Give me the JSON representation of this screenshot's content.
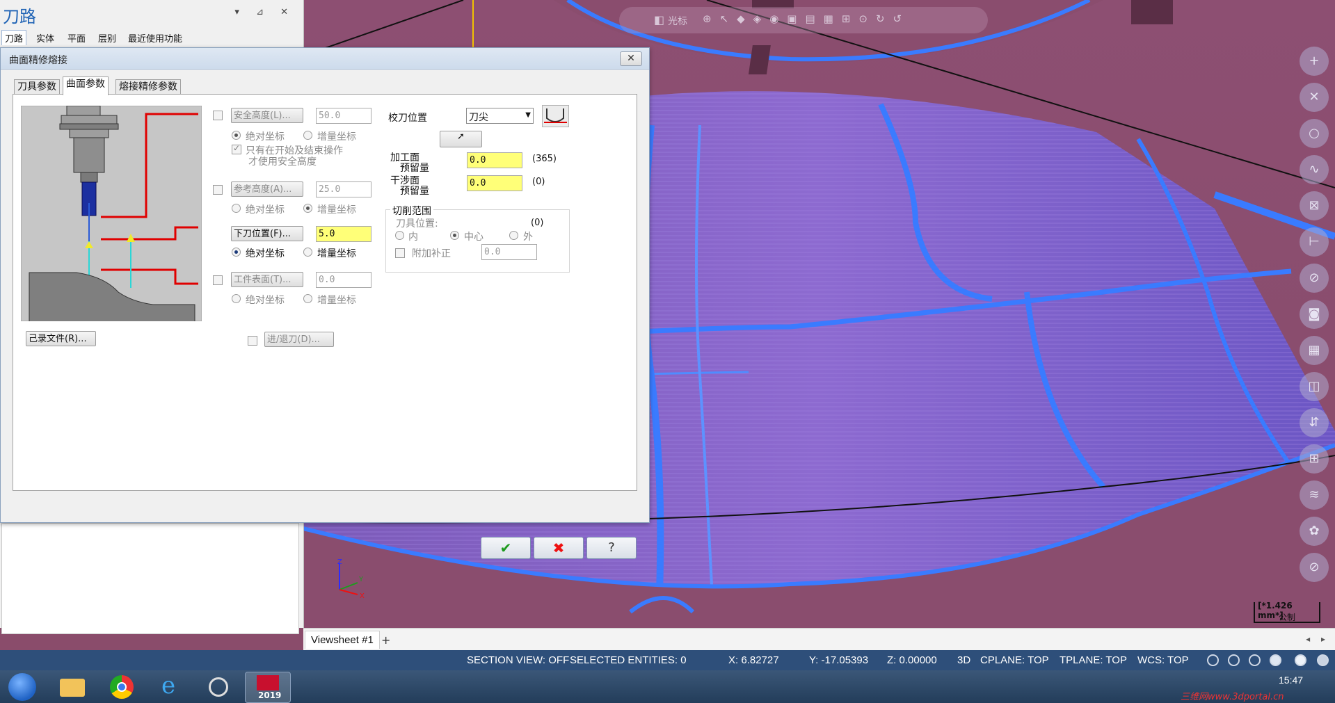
{
  "left_panel": {
    "title": "刀路",
    "controls": "▾ ⊿ ✕",
    "tabs": [
      "刀路",
      "实体",
      "平面",
      "层别",
      "最近使用功能"
    ]
  },
  "dialog": {
    "title": "曲面精修熔接",
    "close_label": "✕",
    "tabs": [
      "刀具参数",
      "曲面参数",
      "熔接精修参数"
    ],
    "record_file_label": "己录文件(R)...",
    "safe_height": {
      "button": "安全高度(L)...",
      "value": "50.0",
      "abs": "绝对坐标",
      "inc": "增量坐标",
      "only_start_end": "只有在开始及结束操作",
      "only_start_end_2": "才使用安全高度"
    },
    "ref_height": {
      "button": "参考高度(A)...",
      "value": "25.0",
      "abs": "绝对坐标",
      "inc": "增量坐标"
    },
    "feed_plane": {
      "button": "下刀位置(F)...",
      "value": "5.0",
      "abs": "绝对坐标",
      "inc": "增量坐标"
    },
    "top_stock": {
      "button": "工件表面(T)...",
      "value": "0.0",
      "abs": "绝对坐标",
      "inc": "增量坐标"
    },
    "entry_exit_label": "进/退刀(D)...",
    "tip_comp": {
      "label": "校刀位置",
      "value": "刀尖"
    },
    "stock_drive": {
      "label1": "加工面",
      "label2": "预留量",
      "value": "0.0",
      "count": "(365)"
    },
    "stock_check": {
      "label1": "干涉面",
      "label2": "预留量",
      "value": "0.0",
      "count": "(0)"
    },
    "cut_range": {
      "title": "切削范围",
      "tool_pos": "刀具位置:",
      "count": "(0)",
      "inside": "内",
      "center": "中心",
      "outside": "外",
      "extra_comp": "附加补正",
      "extra_value": "0.0"
    },
    "ok": "✔",
    "cancel": "✖",
    "help": "?"
  },
  "viewport": {
    "toolbar_text": "光标",
    "scale_value": "[*1.426 mm*]",
    "scale_unit": "公制",
    "tab": "Viewsheet #1",
    "add_tab": "+",
    "scroll_arrows": "◂ ▸",
    "axis_labels": [
      "Z",
      "Y",
      "X"
    ]
  },
  "status_bar": {
    "section_view": "SECTION VIEW: OFF",
    "selected": "SELECTED ENTITIES: 0",
    "x": "X:  6.82727",
    "y": "Y:  -17.05393",
    "z": "Z:  0.00000",
    "mode": "3D",
    "cplane": "CPLANE: TOP",
    "tplane": "TPLANE: TOP",
    "wcs": "WCS: TOP"
  },
  "taskbar": {
    "time": "15:47",
    "mastercam_year": "2019",
    "watermark": "三维网www.3dportal.cn"
  },
  "colors": {
    "viewport_bg": "#8a4d6e",
    "toolpath_blue": "#3a7bff",
    "input_highlight": "#ffff78",
    "status_bar": "#2e4f7a"
  }
}
